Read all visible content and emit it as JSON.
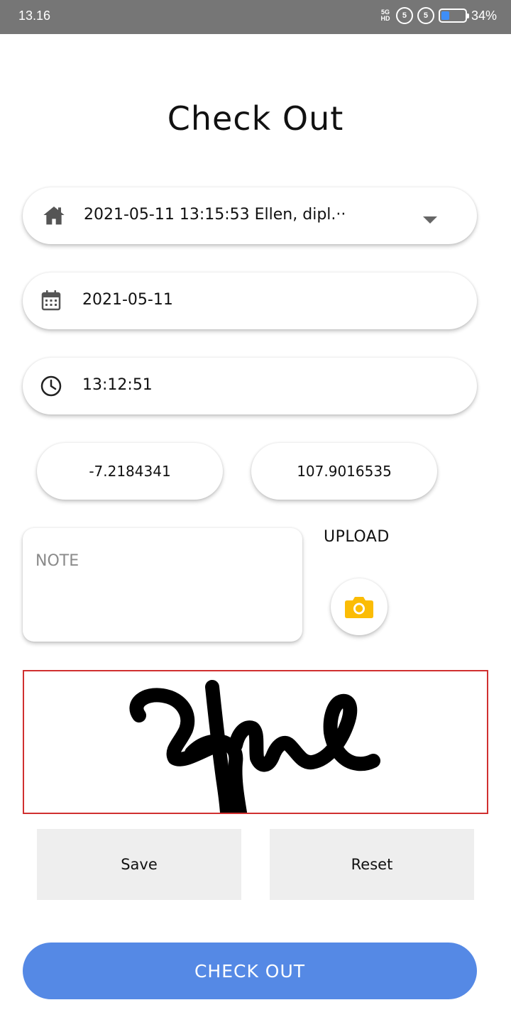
{
  "status_bar": {
    "time": "13.16",
    "network_label": "5G HD",
    "sim1": "5",
    "sim2": "5",
    "battery_percent": "34%",
    "battery_level": 0.34
  },
  "title": "Check Out",
  "schedule_dropdown": {
    "icon": "home-icon",
    "value": "2021-05-11  13:15:53  Ellen, dipl.··"
  },
  "date_field": {
    "icon": "calendar-icon",
    "value": "2021-05-11"
  },
  "time_field": {
    "icon": "clock-icon",
    "value": "13:12:51"
  },
  "coordinates": {
    "latitude": "-7.2184341",
    "longitude": "107.9016535"
  },
  "note": {
    "placeholder": "NOTE",
    "value": ""
  },
  "upload": {
    "label": "UPLOAD",
    "icon": "camera-icon"
  },
  "signature_pad": {},
  "buttons": {
    "save": "Save",
    "reset": "Reset",
    "check_out": "CHECK OUT"
  },
  "colors": {
    "status_bar": "#767676",
    "primary": "#5589e5",
    "camera_icon": "#fbbc05",
    "signature_border": "#d03030",
    "secondary_button": "#eeeeee"
  }
}
